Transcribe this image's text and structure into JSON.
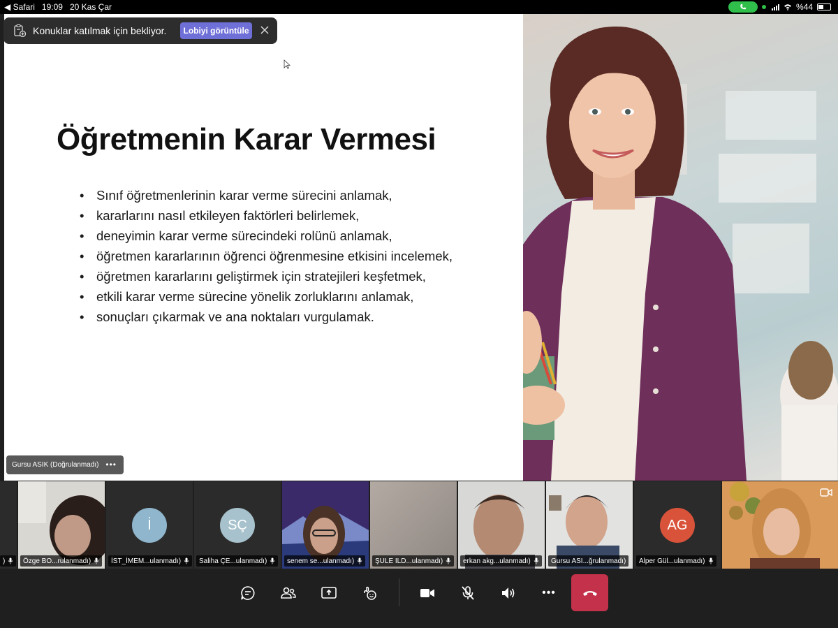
{
  "status_bar": {
    "back_app": "◀ Safari",
    "time": "19:09",
    "date": "20 Kas Çar",
    "battery": "%44",
    "battery_level": 0.44
  },
  "lobby_toast": {
    "message": "Konuklar katılmak için bekliyor.",
    "button_label": "Lobiyi görüntüle"
  },
  "slide": {
    "title": "Öğretmenin Karar Vermesi",
    "bullets": [
      "Sınıf öğretmenlerinin karar verme sürecini anlamak,",
      "kararlarını nasıl etkileyen faktörleri belirlemek,",
      "deneyimin karar verme sürecindeki rolünü anlamak,",
      "öğretmen kararlarının öğrenci öğrenmesine etkisini incelemek,",
      "öğretmen kararlarını geliştirmek için stratejileri keşfetmek,",
      "etkili karar verme sürecine yönelik zorluklarını anlamak,",
      "sonuçları çıkarmak ve ana noktaları vurgulamak."
    ]
  },
  "presenter": {
    "name": "Gursu ASIK (Doğrulanmadı)",
    "more": "•••"
  },
  "participants": [
    {
      "name": "Özge BO...rulanmadı)",
      "type": "video"
    },
    {
      "name": "İST_İMEM...ulanmadı)",
      "type": "avatar",
      "initials": "İ",
      "color": "#8fb6cc"
    },
    {
      "name": "Saliha ÇE...ulanmadı)",
      "type": "avatar",
      "initials": "SÇ",
      "color": "#a7c2cc"
    },
    {
      "name": "senem se...ulanmadı)",
      "type": "video"
    },
    {
      "name": "ŞULE ILD...ulanmadı)",
      "type": "video"
    },
    {
      "name": "erkan akg...ulanmadı)",
      "type": "video"
    },
    {
      "name": "Gursu ASI...ğrulanmadı)",
      "type": "video",
      "active": true
    },
    {
      "name": "Alper Gül...ulanmadı)",
      "type": "avatar",
      "initials": "AG",
      "color": "#d9533a"
    },
    {
      "name": "",
      "type": "video"
    }
  ],
  "partial_left_label": ")",
  "controls": {
    "more": "•••"
  },
  "colors": {
    "accent": "#6f6fd8",
    "hangup": "#c4314b",
    "active_outline": "#7b7be6"
  }
}
